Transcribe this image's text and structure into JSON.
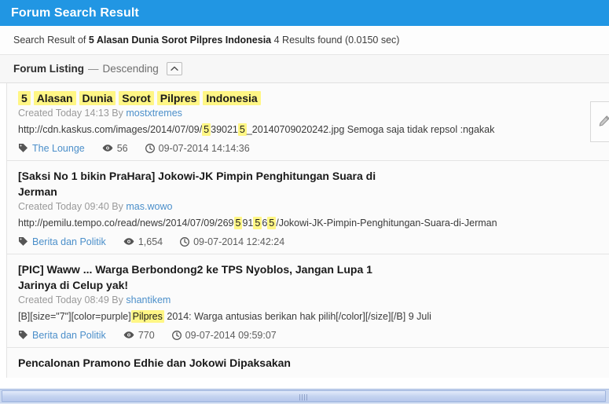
{
  "window": {
    "title": "Forum Search Result"
  },
  "summary": {
    "prefix": "Search Result of",
    "query": "5 Alasan Dunia Sorot Pilpres Indonesia",
    "suffix": "4 Results found (0.0150 sec)"
  },
  "listing": {
    "title": "Forum Listing",
    "dash": "—",
    "order": "Descending",
    "collapse_icon": "chevron-up-icon"
  },
  "icons": {
    "tag": "tag-icon",
    "views": "eye-icon",
    "time": "clock-icon",
    "edit": "pencil-icon"
  },
  "colors": {
    "accent": "#2196e3",
    "link": "#4b8fca",
    "highlight": "#fff685",
    "scrollbar": "#c9d7f0"
  },
  "results": [
    {
      "title_parts": [
        {
          "t": "5",
          "hl": true
        },
        {
          "t": " ",
          "hl": false
        },
        {
          "t": "Alasan",
          "hl": true
        },
        {
          "t": " ",
          "hl": false
        },
        {
          "t": "Dunia",
          "hl": true
        },
        {
          "t": " ",
          "hl": false
        },
        {
          "t": "Sorot",
          "hl": true
        },
        {
          "t": " ",
          "hl": false
        },
        {
          "t": "Pilpres",
          "hl": true
        },
        {
          "t": " ",
          "hl": false
        },
        {
          "t": "Indonesia",
          "hl": true
        }
      ],
      "created_label": "Created Today 14:13 By",
      "author": "mostxtremes",
      "snippet_parts": [
        {
          "t": "http://cdn.kaskus.com/images/2014/07/09/",
          "hl": false
        },
        {
          "t": "5",
          "hl": true
        },
        {
          "t": "39021",
          "hl": false
        },
        {
          "t": "5",
          "hl": true
        },
        {
          "t": "_20140709020242.jpg Semoga saja tidak repsol :ngakak",
          "hl": false
        }
      ],
      "forum": "The Lounge",
      "views": "56",
      "time": "09-07-2014 14:14:36"
    },
    {
      "title_parts": [
        {
          "t": "[Saksi No 1 bikin PraHara] Jokowi-JK Pimpin Penghitungan Suara di Jerman",
          "hl": false
        }
      ],
      "created_label": "Created Today 09:40 By",
      "author": "mas.wowo",
      "snippet_parts": [
        {
          "t": "http://pemilu.tempo.co/read/news/2014/07/09/269",
          "hl": false
        },
        {
          "t": "5",
          "hl": true
        },
        {
          "t": "91",
          "hl": false
        },
        {
          "t": "5",
          "hl": true
        },
        {
          "t": "6",
          "hl": false
        },
        {
          "t": "5",
          "hl": true
        },
        {
          "t": "/Jokowi-JK-Pimpin-Penghitungan-Suara-di-Jerman",
          "hl": false
        }
      ],
      "forum": "Berita dan Politik",
      "views": "1,654",
      "time": "09-07-2014 12:42:24"
    },
    {
      "title_parts": [
        {
          "t": "[PIC] Waww ... Warga Berbondong2 ke TPS Nyoblos, Jangan Lupa 1 Jarinya di Celup yak!",
          "hl": false
        }
      ],
      "created_label": "Created Today 08:49 By",
      "author": "shantikem",
      "snippet_parts": [
        {
          "t": "[B][size=\"7\"][color=purple]",
          "hl": false
        },
        {
          "t": "Pilpres",
          "hl": true
        },
        {
          "t": " 2014: Warga antusias berikan hak pilih[/color][/size][/B] 9 Juli",
          "hl": false
        }
      ],
      "forum": "Berita dan Politik",
      "views": "770",
      "time": "09-07-2014 09:59:07"
    },
    {
      "title_parts": [
        {
          "t": "Pencalonan Pramono Edhie dan Jokowi Dipaksakan",
          "hl": false
        }
      ],
      "created_label": "",
      "author": "",
      "snippet_parts": [],
      "forum": "",
      "views": "",
      "time": ""
    }
  ]
}
